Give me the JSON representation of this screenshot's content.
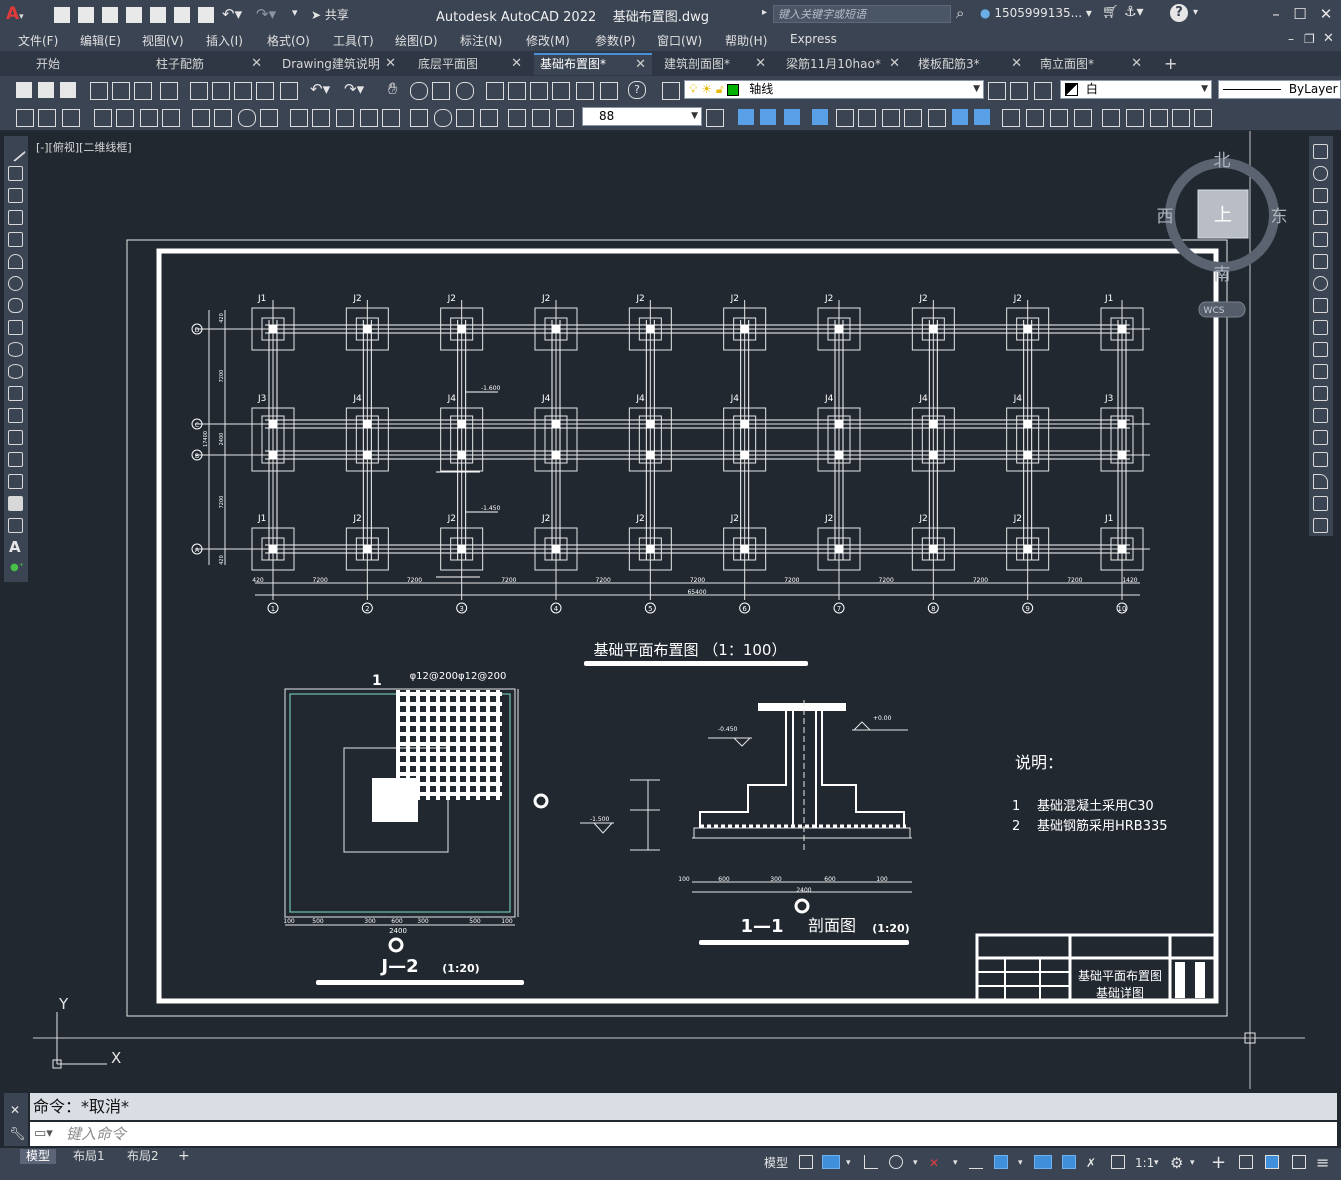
{
  "app": {
    "name": "Autodesk AutoCAD 2022",
    "file": "基础布置图.dwg",
    "search_placeholder": "键入关键字或短语",
    "user": "1505999135...",
    "share": "共享"
  },
  "menu": [
    "文件(F)",
    "编辑(E)",
    "视图(V)",
    "插入(I)",
    "格式(O)",
    "工具(T)",
    "绘图(D)",
    "标注(N)",
    "修改(M)",
    "参数(P)",
    "窗口(W)",
    "帮助(H)",
    "Express"
  ],
  "tabs": [
    {
      "label": "开始",
      "active": false,
      "closable": false
    },
    {
      "label": "柱子配筋",
      "active": false,
      "closable": true
    },
    {
      "label": "Drawing建筑说明",
      "active": false,
      "closable": true
    },
    {
      "label": "底层平面图",
      "active": false,
      "closable": true
    },
    {
      "label": "基础布置图*",
      "active": true,
      "closable": true
    },
    {
      "label": "建筑剖面图*",
      "active": false,
      "closable": true
    },
    {
      "label": "梁筋11月10hao*",
      "active": false,
      "closable": true
    },
    {
      "label": "楼板配筋3*",
      "active": false,
      "closable": true
    },
    {
      "label": "南立面图*",
      "active": false,
      "closable": true
    }
  ],
  "toolbar": {
    "layer_name": "轴线",
    "color_name": "白",
    "linetype": "ByLayer",
    "scale_value": "88"
  },
  "viewport": {
    "label": "[-][俯视][二维线框]",
    "viewcube": {
      "north": "北",
      "south": "南",
      "east": "东",
      "west": "西",
      "top": "上",
      "wcs": "WCS"
    },
    "ucs": {
      "x": "X",
      "y": "Y"
    }
  },
  "drawing": {
    "plan_title": "基础平面布置图 （1：100）",
    "column_labels_top": [
      "J1",
      "J2",
      "J2",
      "J2",
      "J2",
      "J2",
      "J2",
      "J2",
      "J2",
      "J1"
    ],
    "column_labels_mid": [
      "J3",
      "J4",
      "J4",
      "J4",
      "J4",
      "J4",
      "J4",
      "J4",
      "J4",
      "J3"
    ],
    "column_labels_bot": [
      "J1",
      "J2",
      "J2",
      "J2",
      "J2",
      "J2",
      "J2",
      "J2",
      "J2",
      "J1"
    ],
    "axis_numbers": [
      "1",
      "2",
      "3",
      "4",
      "5",
      "6",
      "7",
      "8",
      "9",
      "10"
    ],
    "axis_letters": [
      "D",
      "C",
      "B",
      "A"
    ],
    "bay_dims": [
      "420",
      "7200",
      "7200",
      "7200",
      "7200",
      "7200",
      "7200",
      "7200",
      "7200",
      "7200",
      "1420"
    ],
    "total_dim": "65400",
    "left_dims": [
      "420",
      "7200",
      "2400",
      "7200",
      "420"
    ],
    "left_total": "17400",
    "elev1": "-1.600",
    "elev2": "-1.450",
    "detail_j2_rebar": "φ12@200φ12@200",
    "detail_j2_title": "J—2",
    "detail_j2_scale": "(1:20)",
    "detail_j2_mark": "1",
    "detail_j2_total": "2400",
    "detail_j2_dims": [
      "100",
      "500",
      "300",
      "600",
      "300",
      "500",
      "100"
    ],
    "section_title": "1—1",
    "section_name": "剖面图",
    "section_scale": "(1:20)",
    "section_elev_left": "-0.450",
    "section_elev_right": "+0.00",
    "section_elev_base": "-1.500",
    "section_dims": [
      "100",
      "600",
      "300",
      "600",
      "100"
    ],
    "section_total": "2400",
    "notes_title": "说明：",
    "notes": [
      {
        "num": "1",
        "text": "基础混凝土采用C30"
      },
      {
        "num": "2",
        "text": "基础钢筋采用HRB335"
      }
    ],
    "titleblock_line1": "基础平面布置图",
    "titleblock_line2": "基础详图"
  },
  "command": {
    "output": "命令：*取消*",
    "placeholder": "键入命令"
  },
  "layouts": [
    {
      "label": "模型",
      "active": true
    },
    {
      "label": "布局1",
      "active": false
    },
    {
      "label": "布局2",
      "active": false
    }
  ],
  "status": {
    "model": "模型",
    "scale": "1:1"
  }
}
